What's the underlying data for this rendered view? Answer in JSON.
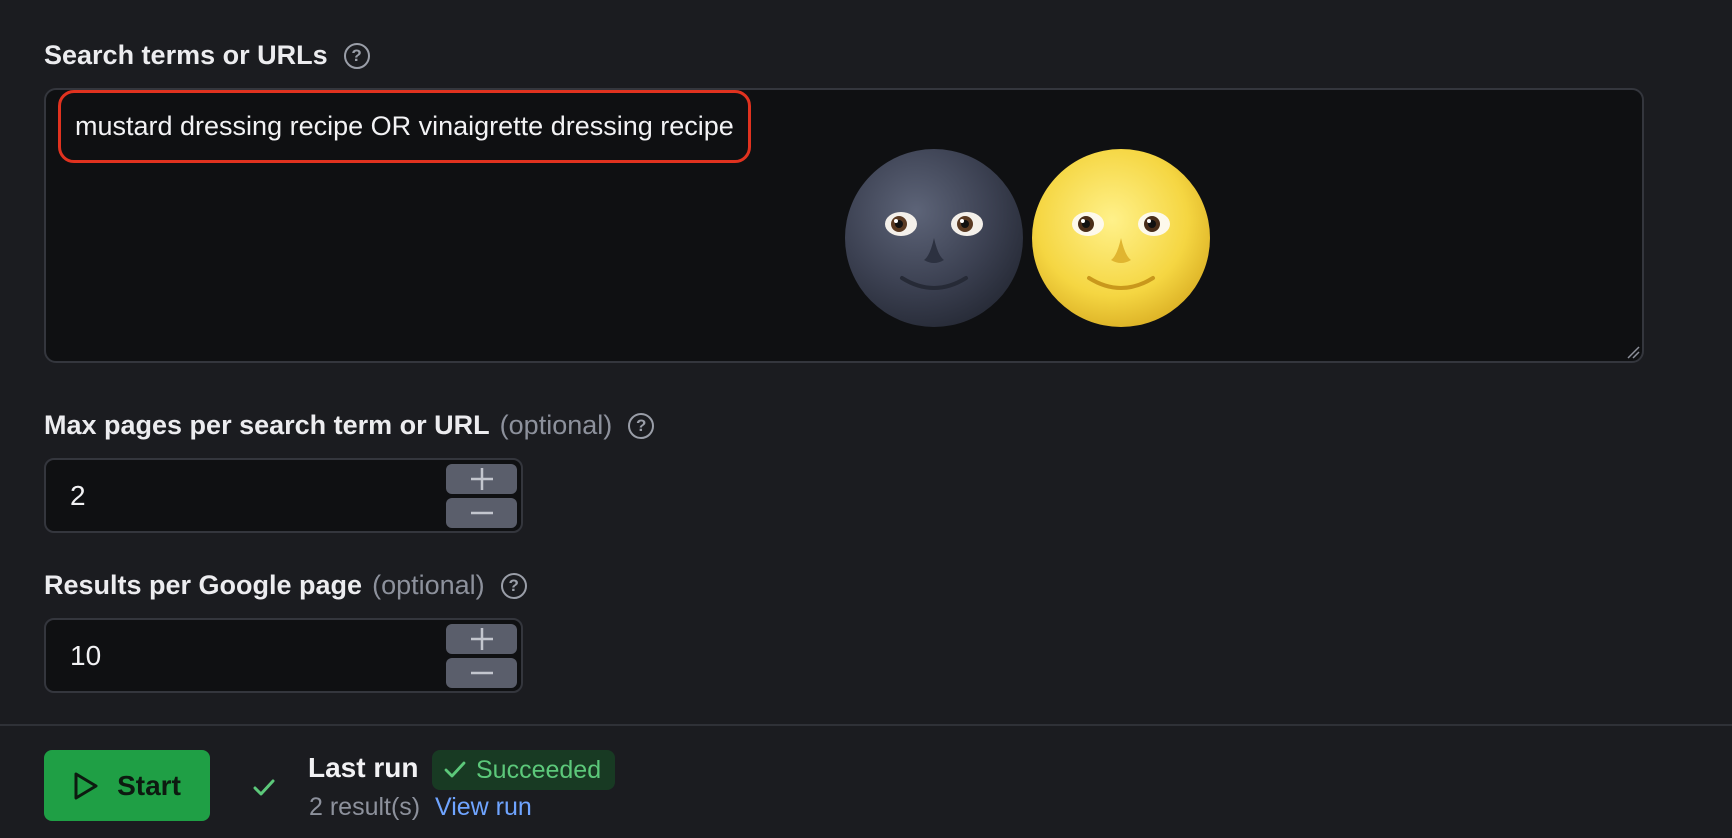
{
  "search_terms": {
    "label": "Search terms or URLs",
    "value": "mustard dressing recipe OR vinaigrette dressing recipe",
    "decorations": [
      "new-moon-face-emoji",
      "full-moon-face-emoji"
    ]
  },
  "max_pages": {
    "label": "Max pages per search term or URL",
    "optional": "(optional)",
    "value": "2"
  },
  "results_per_page": {
    "label": "Results per Google page",
    "optional": "(optional)",
    "value": "10"
  },
  "footer": {
    "start_label": "Start",
    "last_run_title": "Last run",
    "status": "Succeeded",
    "results": "2 result(s)",
    "view_run": "View run"
  },
  "colors": {
    "background": "#1b1c20",
    "input_background": "#0f1012",
    "highlight": "#e0321f",
    "start_button": "#1f9f45",
    "success_text": "#5cc87a",
    "link": "#6fa4ff"
  }
}
